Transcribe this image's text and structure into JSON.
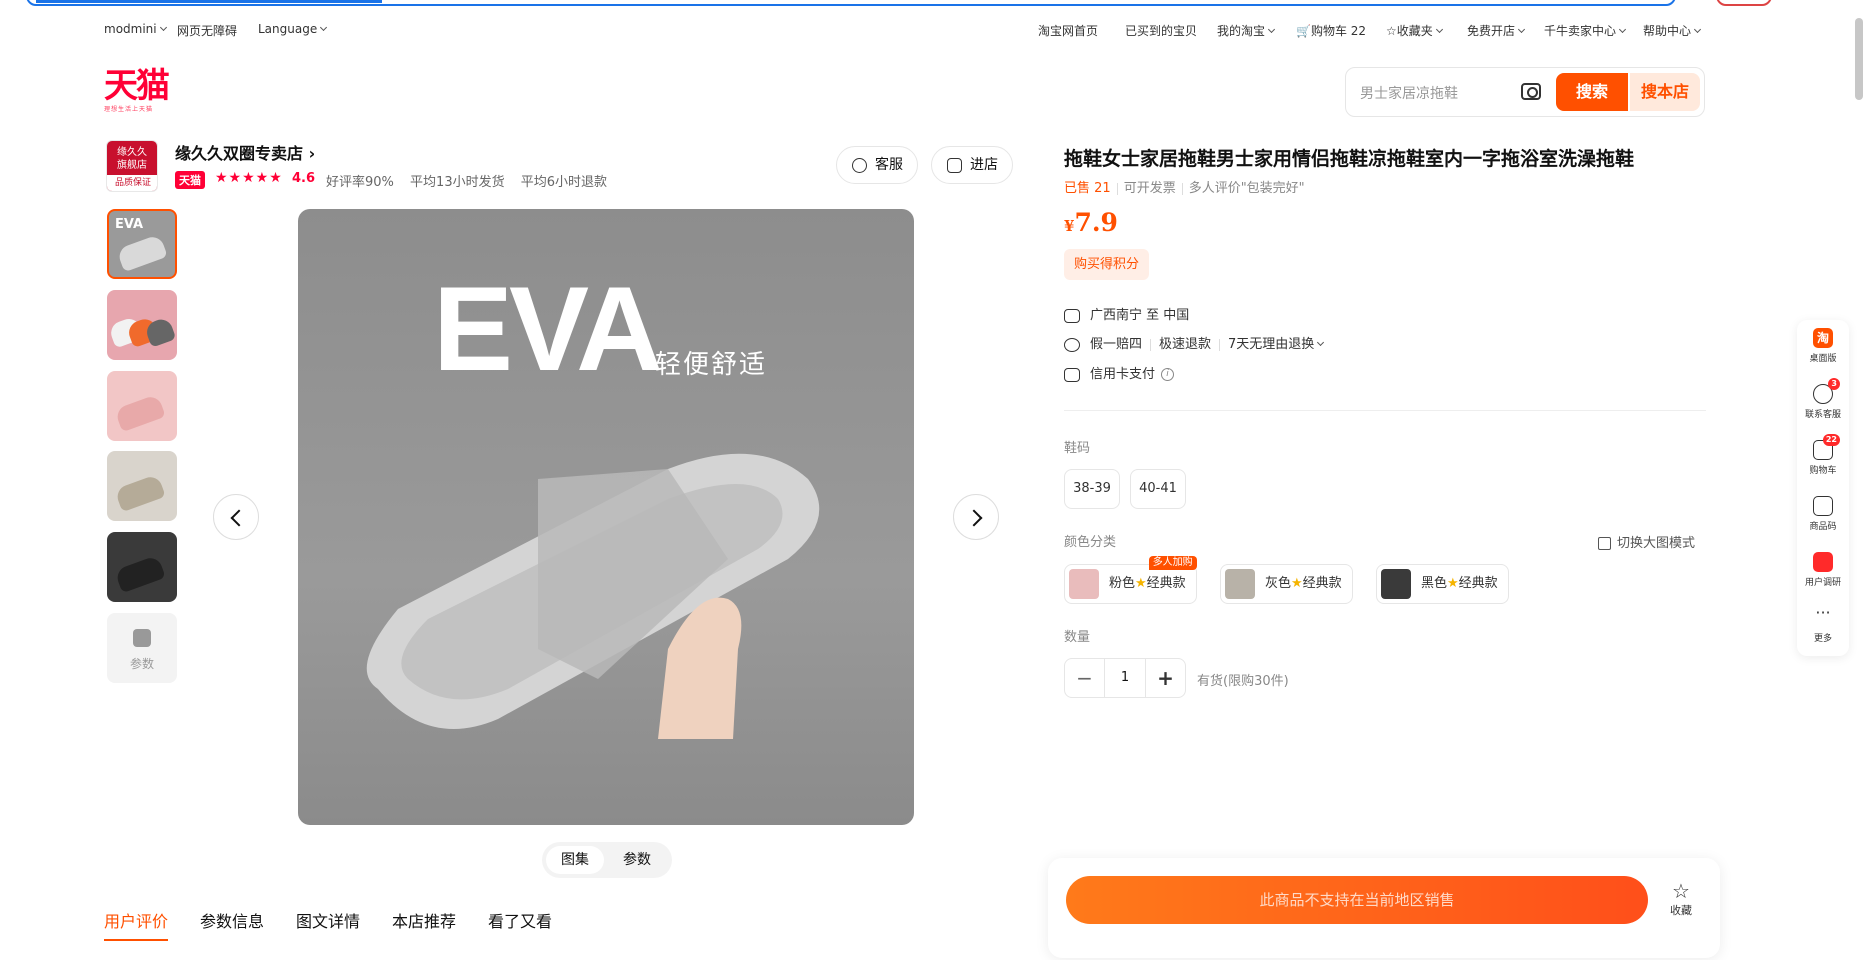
{
  "topnav": {
    "left": [
      "modmini",
      "网页无障碍",
      "Language"
    ],
    "right": [
      "淘宝网首页",
      "已买到的宝贝",
      "我的淘宝",
      "购物车 22",
      "收藏夹",
      "免费开店",
      "千牛卖家中心",
      "帮助中心"
    ]
  },
  "logo": {
    "text": "天猫",
    "sub": "理想生活上天猫"
  },
  "search": {
    "placeholder": "男士家居凉拖鞋",
    "search_label": "搜索",
    "shop_search_label": "搜本店"
  },
  "shop": {
    "logo_line1": "缘久久",
    "logo_line2": "旗舰店",
    "logo_badge": "品质保证",
    "name": "缘久久双圈专卖店 ›",
    "tmall_badge": "天猫",
    "stars": "★★★★★",
    "rating": "4.6",
    "stats": [
      "好评率90%",
      "平均13小时发货",
      "平均6小时退款"
    ],
    "service_label": "客服",
    "enter_label": "进店"
  },
  "gallery": {
    "thumb_params_label": "参数",
    "main_title": "EVA",
    "main_subtitle": "轻便舒适",
    "toggle_gallery": "图集",
    "toggle_params": "参数"
  },
  "tabs": [
    "用户评价",
    "参数信息",
    "图文详情",
    "本店推荐",
    "看了又看"
  ],
  "product": {
    "title": "拖鞋女士家居拖鞋男士家用情侣拖鞋凉拖鞋室内一字拖浴室洗澡拖鞋",
    "sold": "已售 21",
    "invoice": "可开发票",
    "review": "多人评价\"包装完好\"",
    "currency": "¥",
    "price": "7.9",
    "points": "购买得积分",
    "ship": "广西南宁 至 中国",
    "guarantee": [
      "假一赔四",
      "极速退款",
      "7天无理由退换"
    ],
    "pay": "信用卡支付",
    "size_label": "鞋码",
    "sizes": [
      "38-39",
      "40-41"
    ],
    "color_label": "颜色分类",
    "big_mode": "切换大图模式",
    "colors": [
      {
        "name": "粉色",
        "suffix": "经典款",
        "tag": "多人加购",
        "swatch": "#e9bcbc"
      },
      {
        "name": "灰色",
        "suffix": "经典款",
        "tag": "",
        "swatch": "#b8b2a8"
      },
      {
        "name": "黑色",
        "suffix": "经典款",
        "tag": "",
        "swatch": "#3a3a3a"
      }
    ],
    "qty_label": "数量",
    "qty_value": "1",
    "stock": "有货(限购30件)"
  },
  "buybar": {
    "button": "此商品不支持在当前地区销售",
    "fav": "收藏"
  },
  "rside": [
    {
      "label": "桌面版",
      "icon": "淘"
    },
    {
      "label": "联系客服",
      "badge": "3"
    },
    {
      "label": "购物车",
      "badge": "22"
    },
    {
      "label": "商品码"
    },
    {
      "label": "用户调研"
    },
    {
      "label": "更多"
    }
  ],
  "colors": {
    "accent": "#ff5000",
    "tmall_red": "#ff0036"
  }
}
